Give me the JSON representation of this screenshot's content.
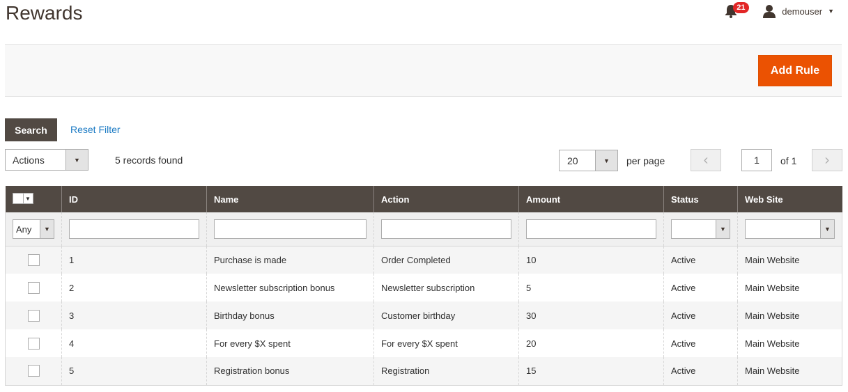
{
  "header": {
    "title": "Rewards",
    "notifications_count": "21",
    "username": "demouser"
  },
  "toolbar": {
    "add_rule_label": "Add Rule",
    "search_label": "Search",
    "reset_filter_label": "Reset Filter",
    "actions_label": "Actions",
    "records_found": "5 records found",
    "per_page_value": "20",
    "per_page_label": "per page",
    "current_page": "1",
    "page_of": "of 1"
  },
  "grid": {
    "columns": [
      "ID",
      "Name",
      "Action",
      "Amount",
      "Status",
      "Web Site"
    ],
    "filter_any": "Any",
    "rows": [
      {
        "id": "1",
        "name": "Purchase is made",
        "action": "Order Completed",
        "amount": "10",
        "status": "Active",
        "website": "Main Website"
      },
      {
        "id": "2",
        "name": "Newsletter subscription bonus",
        "action": "Newsletter subscription",
        "amount": "5",
        "status": "Active",
        "website": "Main Website"
      },
      {
        "id": "3",
        "name": "Birthday bonus",
        "action": "Customer birthday",
        "amount": "30",
        "status": "Active",
        "website": "Main Website"
      },
      {
        "id": "4",
        "name": "For every $X spent",
        "action": "For every $X spent",
        "amount": "20",
        "status": "Active",
        "website": "Main Website"
      },
      {
        "id": "5",
        "name": "Registration bonus",
        "action": "Registration",
        "amount": "15",
        "status": "Active",
        "website": "Main Website"
      }
    ]
  },
  "colors": {
    "primary_action": "#eb5202",
    "header_dark": "#514943",
    "link": "#1979c3",
    "badge": "#e22626"
  }
}
